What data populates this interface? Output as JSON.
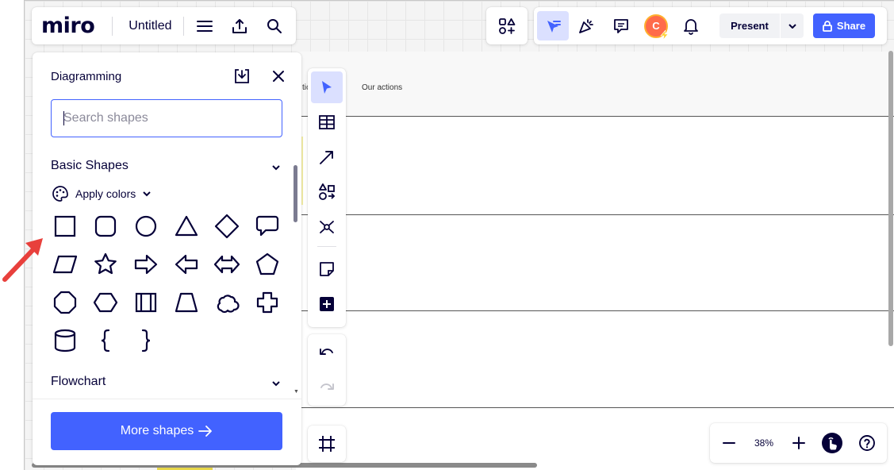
{
  "app": {
    "logo": "miro",
    "board_title": "Untitled"
  },
  "board": {
    "header_label_cut": "tic",
    "header_label": "Our actions"
  },
  "collab": {
    "avatar_initial": "C",
    "present_label": "Present",
    "share_label": "Share"
  },
  "panel": {
    "title": "Diagramming",
    "search_placeholder": "Search shapes",
    "sections": [
      {
        "label": "Basic Shapes"
      },
      {
        "label": "Flowchart"
      }
    ],
    "apply_colors": "Apply colors",
    "more_shapes": "More shapes",
    "shapes": [
      "rectangle",
      "rounded-rectangle",
      "circle",
      "triangle",
      "diamond",
      "speech-bubble",
      "parallelogram",
      "star",
      "arrow-right",
      "arrow-left",
      "double-arrow",
      "pentagon",
      "octagon",
      "hexagon",
      "process",
      "trapezoid",
      "cloud",
      "cross",
      "cylinder",
      "brace-left",
      "brace-right"
    ]
  },
  "zoom": {
    "level": "38%"
  },
  "colors": {
    "accent": "#4262ff",
    "active_bg": "#dbe0ff",
    "arrow_annotation": "#e8403c"
  }
}
